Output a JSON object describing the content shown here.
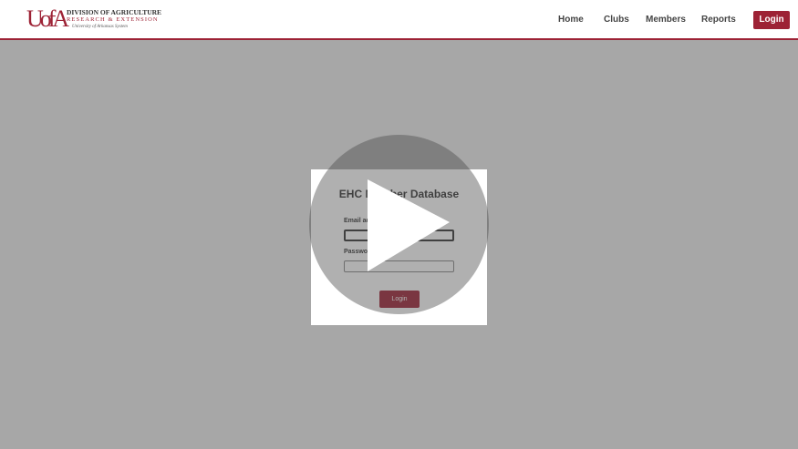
{
  "header": {
    "logo": {
      "mark": "UofA",
      "line1": "DIVISION OF AGRICULTURE",
      "line2": "RESEARCH & EXTENSION",
      "line3": "University of Arkansas System"
    },
    "nav": [
      {
        "label": "Home"
      },
      {
        "label": "Clubs"
      },
      {
        "label": "Members"
      },
      {
        "label": "Reports"
      }
    ],
    "login_label": "Login"
  },
  "login_card": {
    "title": "EHC Member Database",
    "email_label": "Email address",
    "password_label": "Password",
    "email_value": "",
    "password_value": "",
    "submit_label": "Login"
  },
  "overlay": {
    "icon": "play-icon"
  },
  "colors": {
    "brand": "#9d2235",
    "backdrop": "#a7a7a7"
  }
}
